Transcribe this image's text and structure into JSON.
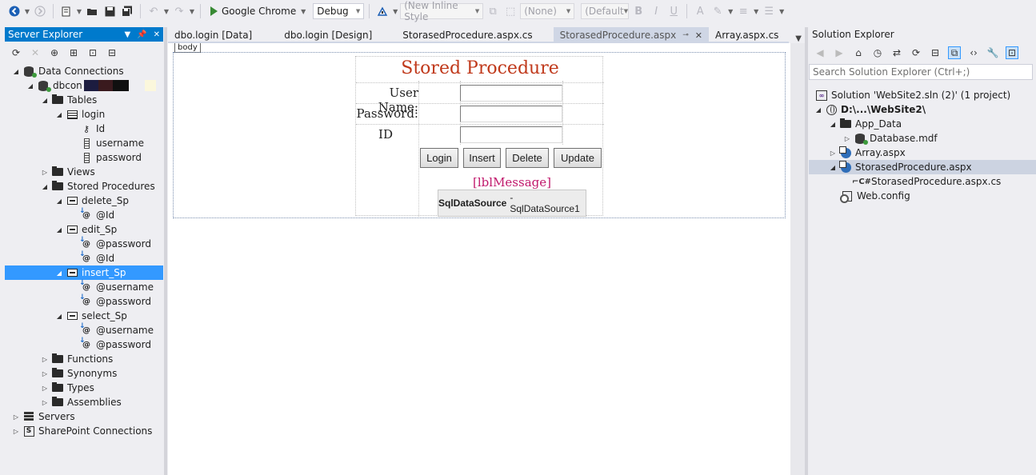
{
  "toolbar": {
    "run_target": "Google Chrome",
    "config": "Debug",
    "style_combo": "(New Inline Style",
    "target_combo": "(None)",
    "font_combo": "(Default",
    "bold": "B",
    "italic": "I",
    "underline": "U"
  },
  "server_explorer": {
    "title": "Server Explorer",
    "nodes": {
      "data_connections": "Data Connections",
      "dbcon": "dbcon",
      "tables": "Tables",
      "login": "login",
      "col_id": "Id",
      "col_username": "username",
      "col_password": "password",
      "views": "Views",
      "stored_procedures": "Stored Procedures",
      "delete_sp": "delete_Sp",
      "delete_sp_id": "@Id",
      "edit_sp": "edit_Sp",
      "edit_sp_password": "@password",
      "edit_sp_id": "@Id",
      "insert_sp": "insert_Sp",
      "insert_sp_username": "@username",
      "insert_sp_password": "@password",
      "select_sp": "select_Sp",
      "select_sp_username": "@username",
      "select_sp_password": "@password",
      "functions": "Functions",
      "synonyms": "Synonyms",
      "types": "Types",
      "assemblies": "Assemblies",
      "servers": "Servers",
      "sharepoint": "SharePoint Connections"
    }
  },
  "tabs": [
    {
      "label": "dbo.login [Data]"
    },
    {
      "label": "dbo.login [Design]"
    },
    {
      "label": "StorasedProcedure.aspx.cs"
    },
    {
      "label": "StorasedProcedure.aspx"
    },
    {
      "label": "Array.aspx.cs"
    }
  ],
  "design": {
    "body_tag": "body",
    "title": "Stored Procedure",
    "username_label": "User Name:",
    "password_label": "Password:",
    "id_label": "ID",
    "buttons": {
      "login": "Login",
      "insert": "Insert",
      "delete": "Delete",
      "update": "Update"
    },
    "lbl_message": "[lblMessage]",
    "sqlds_type": "SqlDataSource",
    "sqlds_name": "- SqlDataSource1"
  },
  "solution_explorer": {
    "title": "Solution Explorer",
    "search_placeholder": "Search Solution Explorer (Ctrl+;)",
    "nodes": {
      "solution": "Solution 'WebSite2.sln (2)' (1 project)",
      "project": "D:\\...\\WebSite2\\",
      "app_data": "App_Data",
      "database": "Database.mdf",
      "array": "Array.aspx",
      "stored_proc": "StorasedProcedure.aspx",
      "stored_proc_cs": "StorasedProcedure.aspx.cs",
      "web_config": "Web.config"
    }
  },
  "colors": {
    "accent": "#007acc",
    "selection": "#3399ff",
    "title_red": "#c0391b",
    "message_magenta": "#c0176b"
  }
}
